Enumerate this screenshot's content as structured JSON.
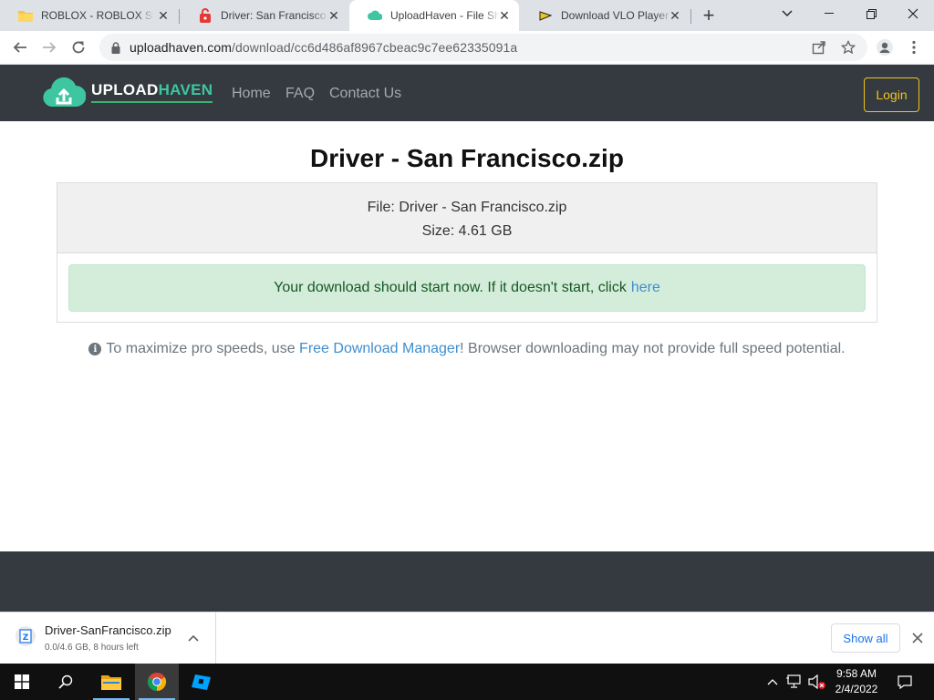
{
  "browser": {
    "tabs": [
      {
        "title": "ROBLOX - ROBLOX Stan",
        "icon": "folder-icon"
      },
      {
        "title": "Driver: San Francisco Fr",
        "icon": "lock-download-icon"
      },
      {
        "title": "UploadHaven - File Sha",
        "icon": "uploadhaven-icon"
      },
      {
        "title": "Download VLO Player",
        "icon": "vlo-icon"
      }
    ],
    "new_tab_label": "+",
    "url_host": "uploadhaven.com",
    "url_path": "/download/cc6d486af8967cbeac9c7ee62335091a"
  },
  "site": {
    "logo_text_1": "UPLOAD",
    "logo_text_2": "HAVEN",
    "nav": [
      "Home",
      "FAQ",
      "Contact Us"
    ],
    "login_label": "Login",
    "colors": {
      "header_bg": "#343a40",
      "accent": "#3ec6a0",
      "login": "#f0c419",
      "alert_bg": "#d4edda",
      "link": "#3e8ecf"
    }
  },
  "main": {
    "file_title": "Driver - San Francisco.zip",
    "file_line": "File: Driver - San Francisco.zip",
    "size_line": "Size: 4.61 GB",
    "alert_text": "Your download should start now. If it doesn't start, click",
    "alert_link": "here",
    "info_prefix": "To maximize pro speeds, use ",
    "info_link": "Free Download Manager",
    "info_suffix": "! Browser downloading may not provide full speed potential."
  },
  "download_shelf": {
    "file_name": "Driver-SanFrancisco.zip",
    "status": "0.0/4.6 GB, 8 hours left",
    "show_all_label": "Show all"
  },
  "taskbar": {
    "time": "9:58 AM",
    "date": "2/4/2022"
  }
}
